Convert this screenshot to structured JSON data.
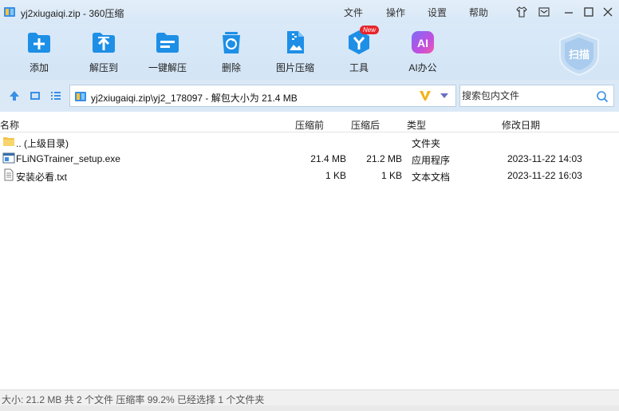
{
  "window": {
    "title": "yj2xiugaiqi.zip - 360压缩",
    "menu": [
      "文件",
      "操作",
      "设置",
      "帮助"
    ]
  },
  "toolbar": {
    "items": [
      {
        "label": "添加",
        "icon": "add-icon"
      },
      {
        "label": "解压到",
        "icon": "extract-to-icon"
      },
      {
        "label": "一键解压",
        "icon": "one-click-extract-icon"
      },
      {
        "label": "删除",
        "icon": "delete-icon"
      },
      {
        "label": "图片压缩",
        "icon": "image-compress-icon"
      },
      {
        "label": "工具",
        "icon": "tools-icon",
        "badge": "New"
      },
      {
        "label": "AI办公",
        "icon": "ai-office-icon"
      }
    ],
    "scan_label": "扫描"
  },
  "address": {
    "path": "yj2xiugaiqi.zip\\yj2_178097 - 解包大小为 21.4 MB",
    "search_placeholder": "搜索包内文件"
  },
  "list": {
    "columns": [
      "名称",
      "压缩前",
      "压缩后",
      "类型",
      "修改日期"
    ],
    "rows": [
      {
        "name": ".. (上级目录)",
        "before": "",
        "after": "",
        "type": "文件夹",
        "date": "",
        "icon": "folder-icon"
      },
      {
        "name": "FLiNGTrainer_setup.exe",
        "before": "21.4 MB",
        "after": "21.2 MB",
        "type": "应用程序",
        "date": "2023-11-22 14:03",
        "icon": "exe-file-icon"
      },
      {
        "name": "安装必看.txt",
        "before": "1 KB",
        "after": "1 KB",
        "type": "文本文档",
        "date": "2023-11-22 16:03",
        "icon": "text-file-icon"
      }
    ]
  },
  "status": {
    "text": "大小: 21.2 MB 共 2 个文件 压缩率 99.2% 已经选择 1 个文件夹"
  },
  "colors": {
    "accent": "#1e8fe6",
    "toolbar_bg": "#d5e6f6",
    "folder": "#f3c34a"
  }
}
